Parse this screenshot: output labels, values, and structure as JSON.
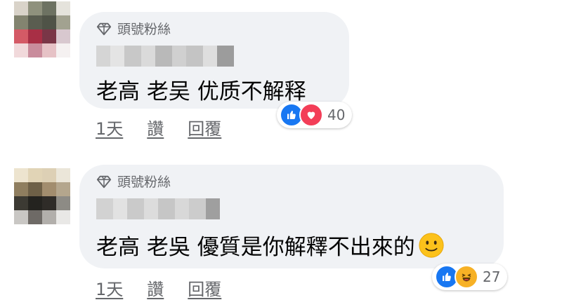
{
  "comments": [
    {
      "badge": "頭號粉絲",
      "text": "老高 老吴 优质不解释",
      "reaction_count": "40",
      "reactions": [
        "like-icon",
        "love-icon"
      ],
      "time": "1天",
      "like_label": "讚",
      "reply_label": "回覆"
    },
    {
      "badge": "頭號粉絲",
      "text": "老高 老吳 優質是你解釋不出來的",
      "emoji": "slightly-smiling-face-icon",
      "reaction_count": "27",
      "reactions": [
        "like-icon",
        "haha-icon"
      ],
      "time": "1天",
      "like_label": "讚",
      "reply_label": "回覆"
    }
  ],
  "colors": {
    "bubble": "#f0f2f5",
    "like_blue": "#1877f2",
    "love_red": "#f33e58",
    "haha_yellow": "#f7b125",
    "meta_gray": "#65676b"
  }
}
